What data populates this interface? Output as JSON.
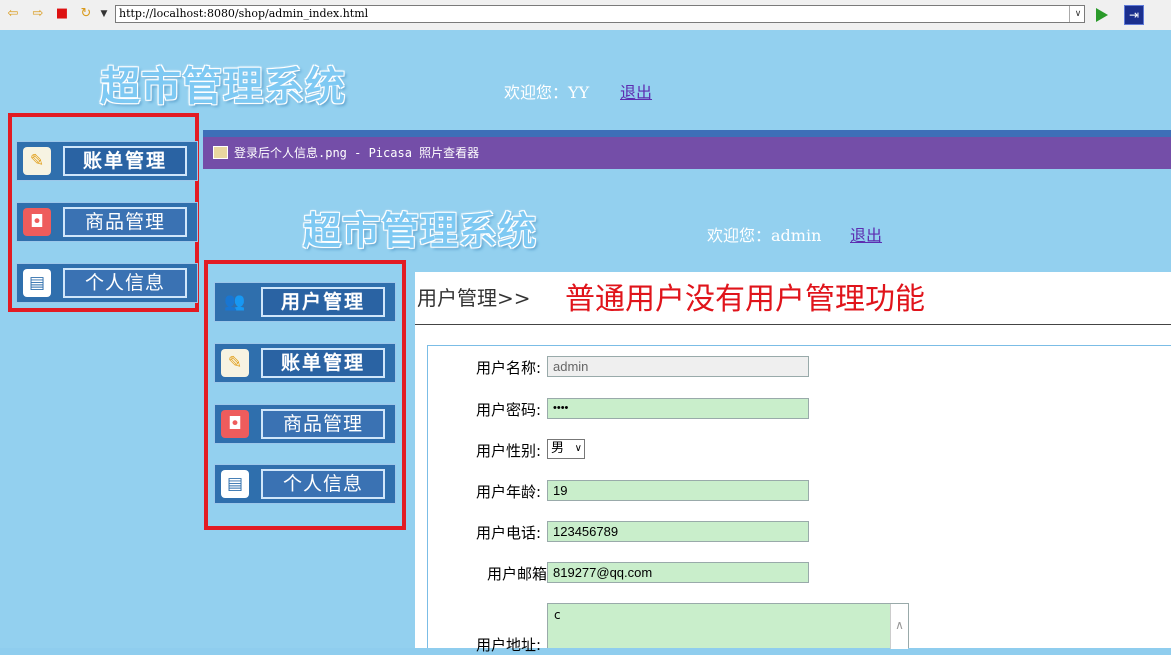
{
  "browser": {
    "address": "http://localhost:8080/shop/admin_index.html",
    "toolbar_icons": [
      "back-arrow-icon",
      "forward-arrow-icon",
      "stop-icon",
      "refresh-icon",
      "dropdown-icon"
    ],
    "go_icon": "go-arrow-icon",
    "extension_icon": "extension-icon"
  },
  "background_page": {
    "logo": "超市管理系统",
    "welcome": "欢迎您：YY",
    "logout": "退出",
    "menu": [
      {
        "icon": "notepad-icon",
        "label": "账单管理"
      },
      {
        "icon": "shopping-bag-icon",
        "label": "商品管理"
      },
      {
        "icon": "id-card-icon",
        "label": "个人信息"
      }
    ]
  },
  "viewer_window": {
    "title": "登录后个人信息.png - Picasa 照片查看器",
    "logo": "超市管理系统",
    "welcome": "欢迎您：admin",
    "logout": "退出",
    "menu": [
      {
        "icon": "users-icon",
        "label": "用户管理"
      },
      {
        "icon": "notepad-icon",
        "label": "账单管理"
      },
      {
        "icon": "shopping-bag-icon",
        "label": "商品管理"
      },
      {
        "icon": "id-card-icon",
        "label": "个人信息"
      }
    ],
    "breadcrumb": "用户管理>>",
    "notice": "普通用户没有用户管理功能",
    "form": {
      "username_label": "用户名称:",
      "username_value": "admin",
      "password_label": "用户密码:",
      "password_value": "••••",
      "gender_label": "用户性别:",
      "gender_value": "男",
      "age_label": "用户年龄:",
      "age_value": "19",
      "phone_label": "用户电话:",
      "phone_value": "123456789",
      "email_label": "用户邮箱",
      "email_value": "819277@qq.com",
      "address_label": "用户地址:",
      "address_value": "c"
    }
  },
  "colors": {
    "page_bg": "#93d0ef",
    "titlebar": "#744ea8",
    "highlight_box": "#e21b23",
    "notice": "#e0141b",
    "input_bg": "#c9eecb"
  }
}
